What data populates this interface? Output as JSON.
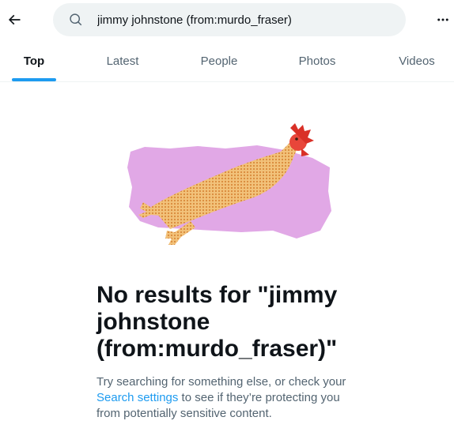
{
  "search": {
    "query": "jimmy johnstone (from:murdo_fraser)"
  },
  "icons": {
    "back": "arrow-left-icon",
    "search": "search-icon",
    "more": "more-horizontal-icon"
  },
  "tabs": [
    {
      "label": "Top",
      "active": true
    },
    {
      "label": "Latest",
      "active": false
    },
    {
      "label": "People",
      "active": false
    },
    {
      "label": "Photos",
      "active": false
    },
    {
      "label": "Videos",
      "active": false
    }
  ],
  "empty_state": {
    "title": "No results for \"jimmy johnstone (from:murdo_fraser)\"",
    "desc_before": "Try searching for something else, or check your ",
    "desc_link": "Search settings",
    "desc_after": " to see if they’re protecting you from potentially sensitive content."
  },
  "colors": {
    "accent": "#1d9bf0",
    "text_primary": "#0f1419",
    "text_secondary": "#536471",
    "search_bg": "#eff3f4",
    "illustration_bg": "#e1a8e6"
  }
}
